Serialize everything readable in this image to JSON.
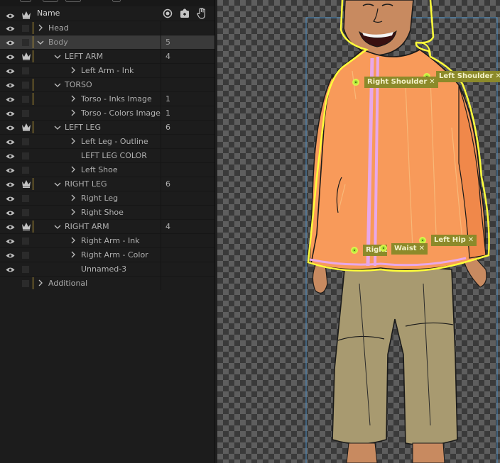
{
  "header": {
    "name_label": "Name"
  },
  "layers": [
    {
      "name": "Head",
      "indent": 0,
      "expanded": false,
      "crown": false,
      "count": "",
      "selected": false,
      "bar": true
    },
    {
      "name": "Body",
      "indent": 0,
      "expanded": true,
      "crown": false,
      "count": "5",
      "selected": true,
      "bar": true
    },
    {
      "name": "LEFT ARM",
      "indent": 1,
      "expanded": true,
      "crown": true,
      "count": "4",
      "selected": false,
      "bar": true
    },
    {
      "name": "Left Arm - Ink",
      "indent": 2,
      "expanded": false,
      "crown": false,
      "count": "",
      "selected": false,
      "bar": false
    },
    {
      "name": "TORSO",
      "indent": 1,
      "expanded": true,
      "crown": false,
      "count": "",
      "selected": false,
      "bar": true
    },
    {
      "name": "Torso - Inks Image",
      "indent": 2,
      "expanded": false,
      "crown": false,
      "count": "1",
      "selected": false,
      "bar": true
    },
    {
      "name": "Torso - Colors Image",
      "indent": 2,
      "expanded": false,
      "crown": false,
      "count": "1",
      "selected": false,
      "bar": false
    },
    {
      "name": "LEFT LEG",
      "indent": 1,
      "expanded": true,
      "crown": true,
      "count": "6",
      "selected": false,
      "bar": true
    },
    {
      "name": "Left Leg - Outline",
      "indent": 2,
      "expanded": false,
      "crown": false,
      "count": "",
      "selected": false,
      "bar": false
    },
    {
      "name": "LEFT LEG COLOR",
      "indent": 2,
      "expanded": null,
      "crown": false,
      "count": "",
      "selected": false,
      "bar": false
    },
    {
      "name": "Left Shoe",
      "indent": 2,
      "expanded": false,
      "crown": false,
      "count": "",
      "selected": false,
      "bar": false
    },
    {
      "name": "RIGHT LEG",
      "indent": 1,
      "expanded": true,
      "crown": true,
      "count": "6",
      "selected": false,
      "bar": true
    },
    {
      "name": "Right Leg",
      "indent": 2,
      "expanded": false,
      "crown": false,
      "count": "",
      "selected": false,
      "bar": false
    },
    {
      "name": "Right Shoe",
      "indent": 2,
      "expanded": false,
      "crown": false,
      "count": "",
      "selected": false,
      "bar": false
    },
    {
      "name": "RIGHT ARM",
      "indent": 1,
      "expanded": true,
      "crown": true,
      "count": "4",
      "selected": false,
      "bar": true
    },
    {
      "name": "Right Arm - Ink",
      "indent": 2,
      "expanded": false,
      "crown": false,
      "count": "",
      "selected": false,
      "bar": false
    },
    {
      "name": "Right Arm - Color",
      "indent": 2,
      "expanded": false,
      "crown": false,
      "count": "",
      "selected": false,
      "bar": false
    },
    {
      "name": "Unnamed-3",
      "indent": 2,
      "expanded": null,
      "crown": false,
      "count": "",
      "selected": false,
      "bar": false
    },
    {
      "name": "Additional",
      "indent": 0,
      "expanded": false,
      "crown": false,
      "count": "",
      "selected": false,
      "bar": true,
      "hidden": true
    }
  ],
  "handles": {
    "left_shoulder": "Left Shoulder",
    "right_shoulder": "Right Shoulder",
    "left_hip": "Left Hip",
    "waist": "Waist",
    "right_hip": "Right Hip"
  },
  "colors": {
    "panel_bg": "#1c1c1c",
    "selected_row": "#3a3a3a",
    "tag_bg": "#8c8a2a",
    "handle_green": "#a8e23a",
    "outline_yellow": "#ffff3a",
    "jacket": "#f89a5a",
    "pants": "#a89a70",
    "skin": "#c88a60"
  }
}
